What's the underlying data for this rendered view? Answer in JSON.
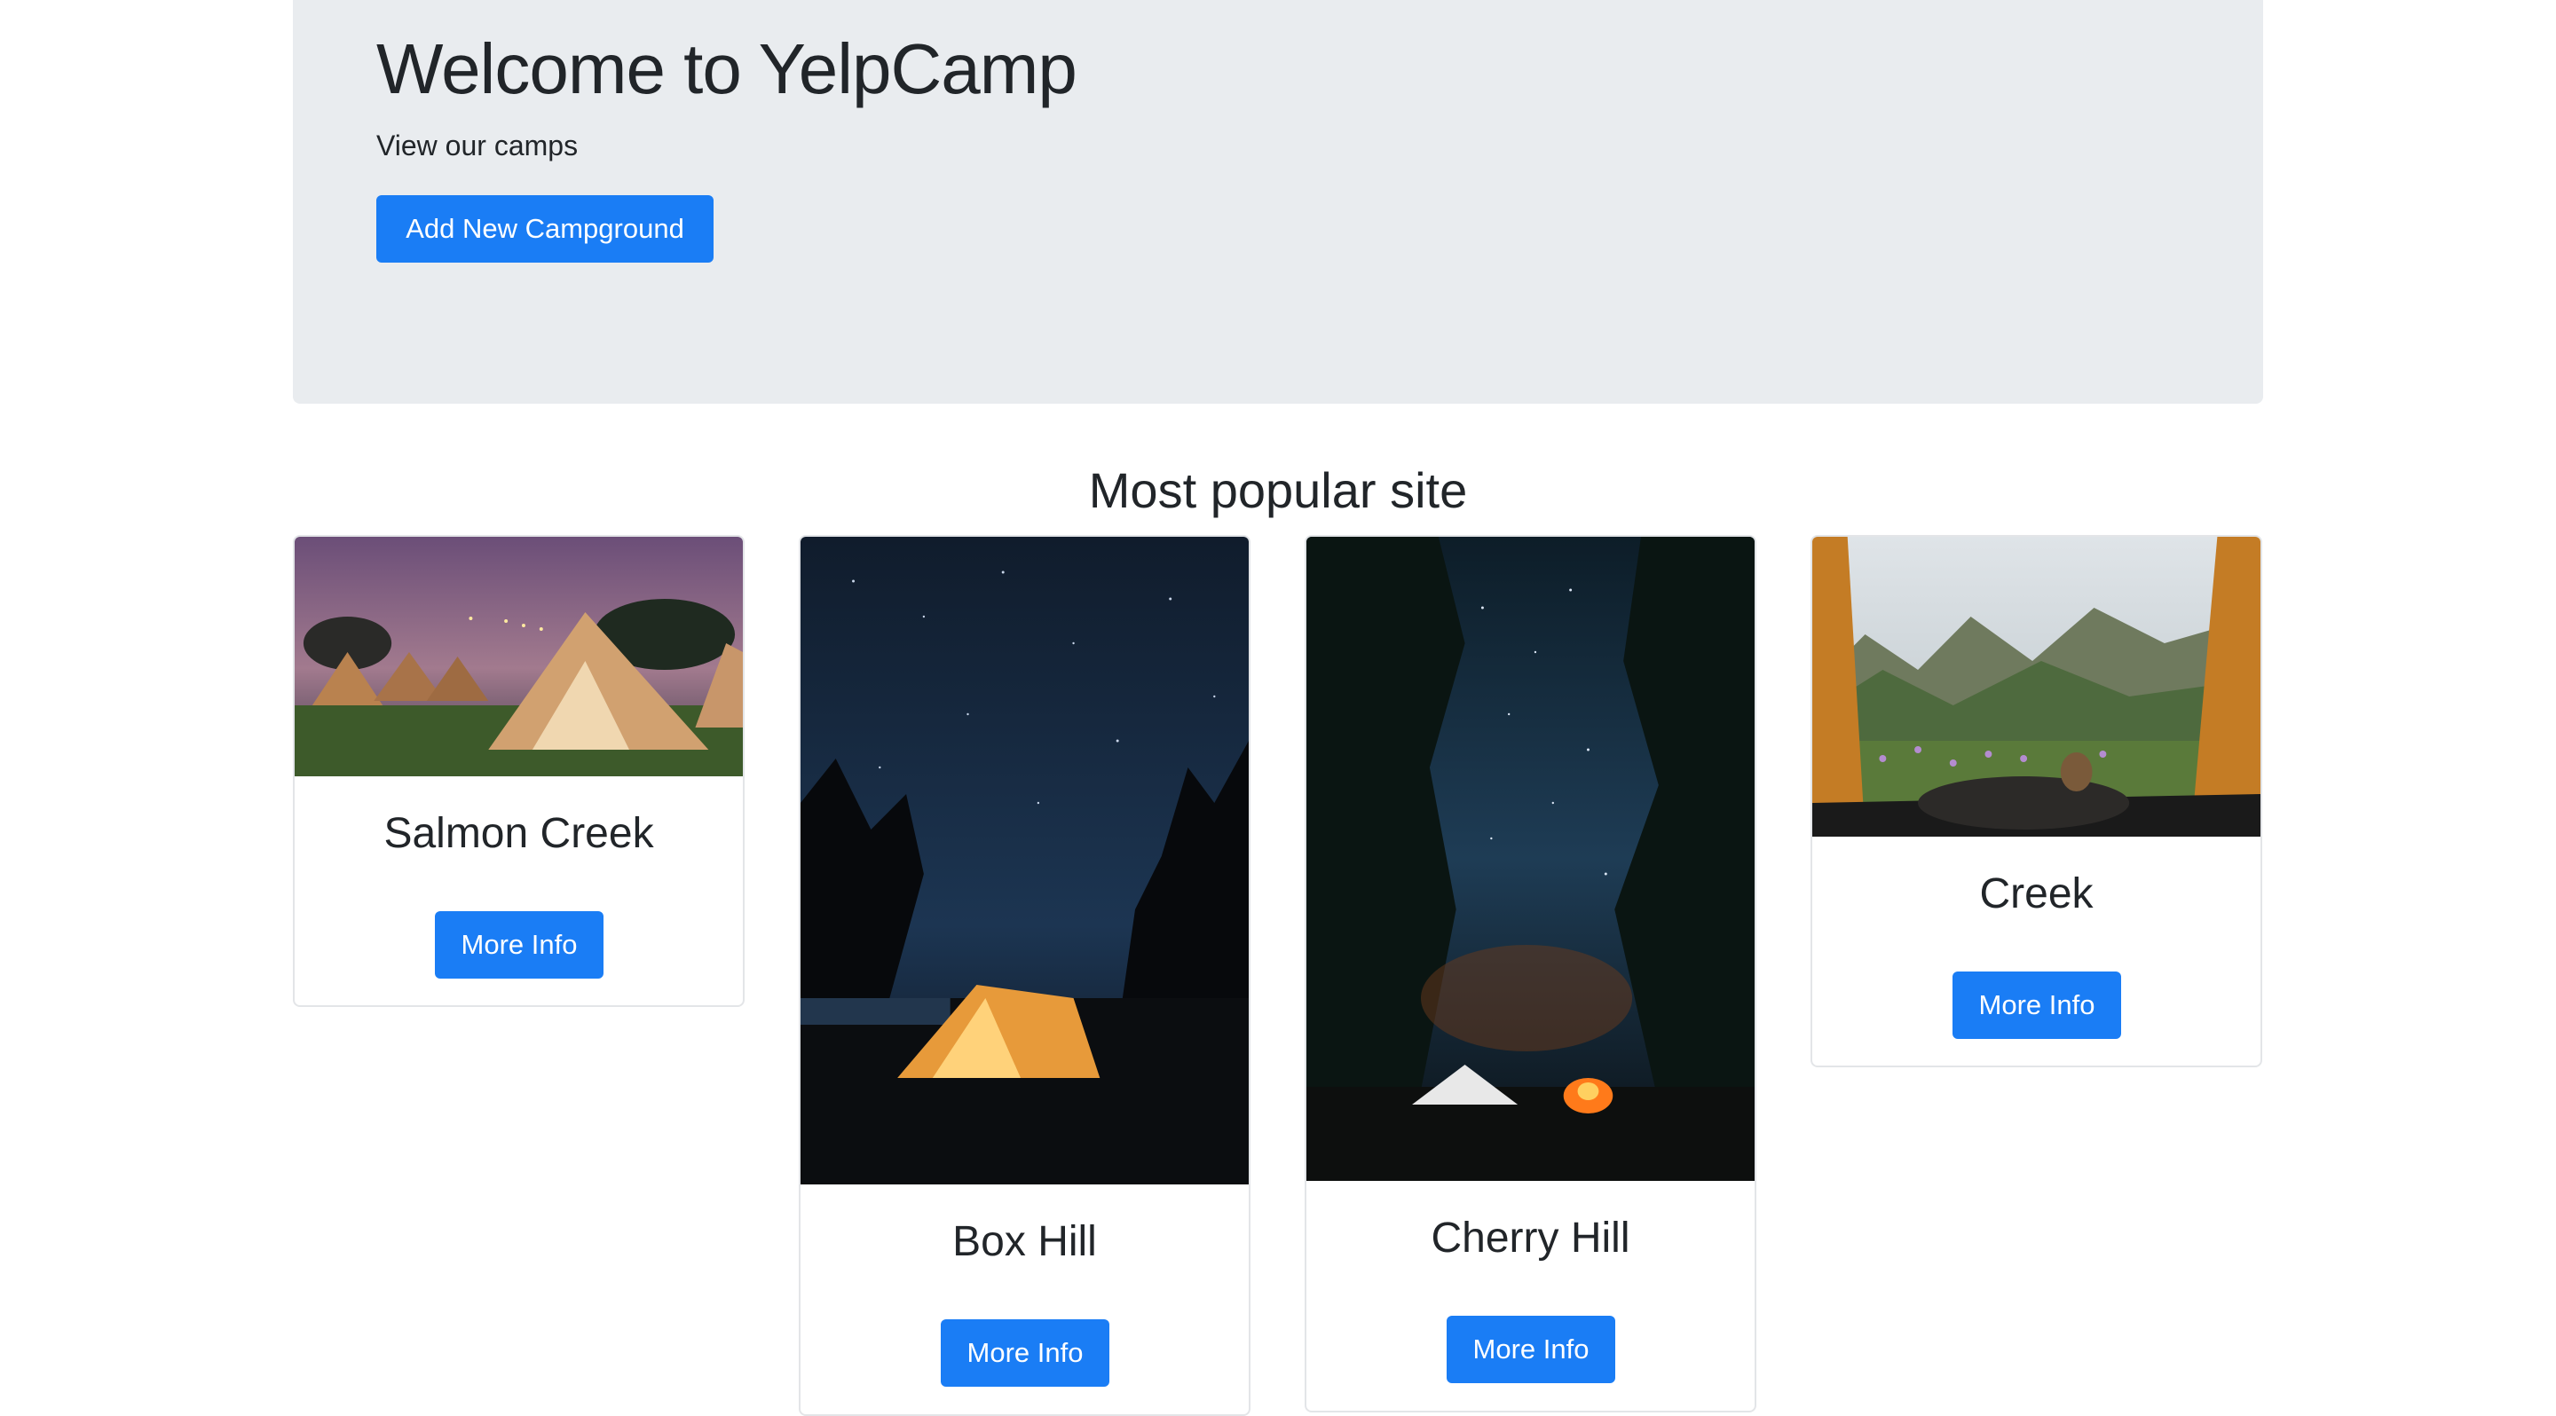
{
  "hero": {
    "title": "Welcome to YelpCamp",
    "subtitle": "View our camps",
    "add_button_label": "Add New Campground"
  },
  "section": {
    "title": "Most popular site"
  },
  "campgrounds": [
    {
      "name": "Salmon Creek",
      "button_label": "More Info"
    },
    {
      "name": "Box Hill",
      "button_label": "More Info"
    },
    {
      "name": "Cherry Hill",
      "button_label": "More Info"
    },
    {
      "name": "Creek",
      "button_label": "More Info"
    }
  ],
  "colors": {
    "primary": "#1a7df5",
    "jumbotron_bg": "#e9ecef",
    "text": "#212529"
  }
}
